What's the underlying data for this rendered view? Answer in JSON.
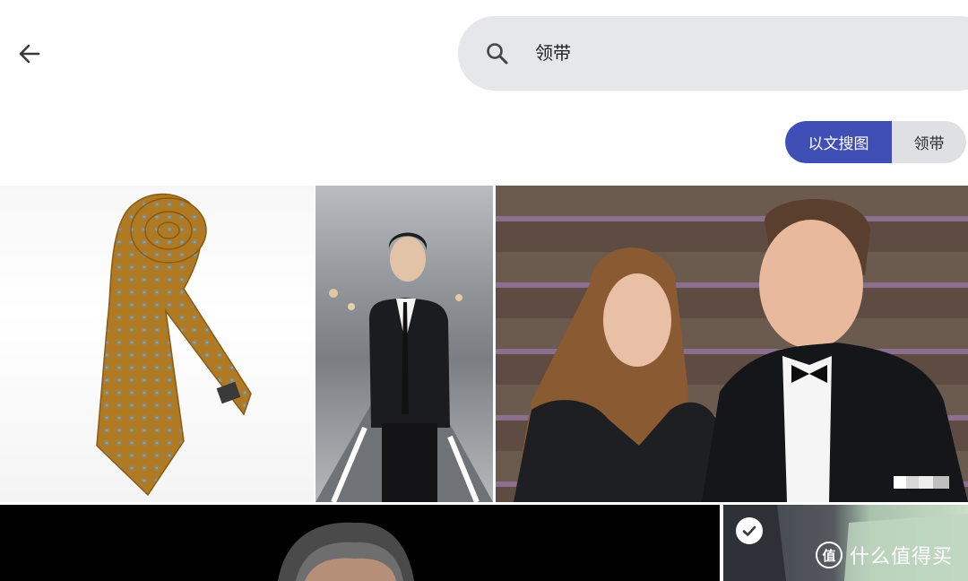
{
  "header": {
    "back_icon": "arrow-left-icon",
    "search": {
      "icon": "search-icon",
      "query": "领带"
    }
  },
  "mode_toggle": {
    "active_label": "以文搜图",
    "inactive_label": "领带",
    "accent_color": "#3f4fb5"
  },
  "results": [
    {
      "subject": "tie-photo"
    },
    {
      "subject": "man-in-suit-street-photo"
    },
    {
      "subject": "couple-formal-event-photo"
    },
    {
      "subject": "man-portrait-dark-photo"
    },
    {
      "subject": "man-green-background-photo"
    }
  ],
  "selection": {
    "icon": "checkmark-icon"
  },
  "watermark": {
    "logo_text": "值",
    "text": "什么值得买"
  }
}
